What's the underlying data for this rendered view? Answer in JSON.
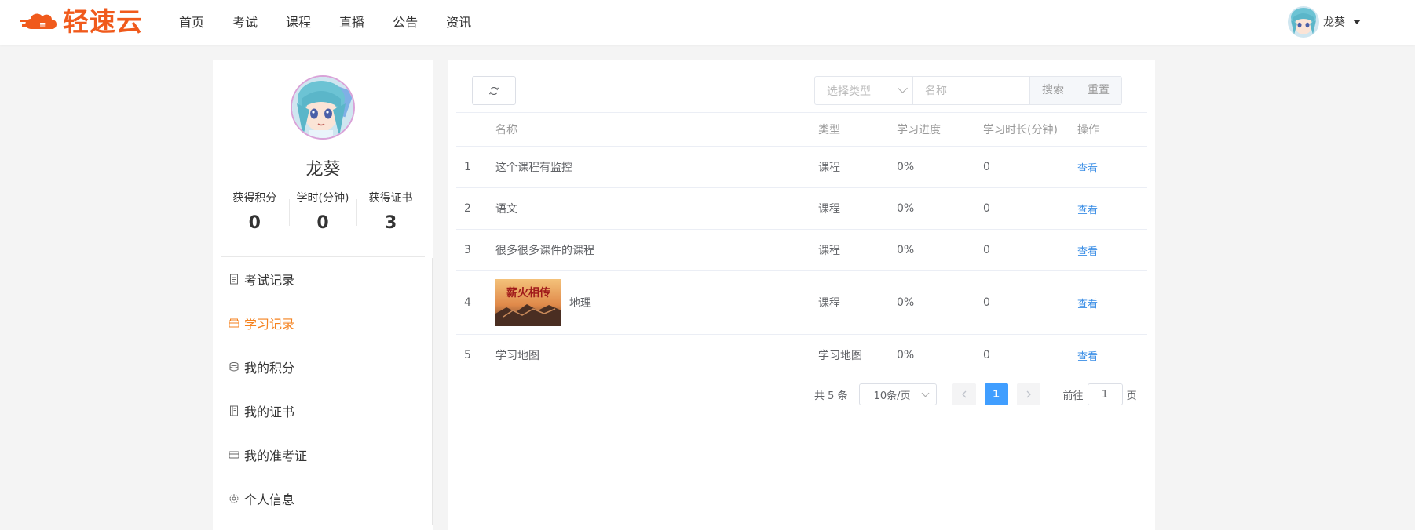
{
  "header": {
    "logo_text": "轻速云",
    "nav": [
      "首页",
      "考试",
      "课程",
      "直播",
      "公告",
      "资讯"
    ],
    "user_name": "龙葵"
  },
  "profile": {
    "name": "龙葵",
    "stats": [
      {
        "label": "获得积分",
        "value": "0"
      },
      {
        "label": "学时(分钟)",
        "value": "0"
      },
      {
        "label": "获得证书",
        "value": "3"
      }
    ]
  },
  "sidebar": {
    "items": [
      {
        "label": "考试记录",
        "icon": "document-icon",
        "active": false
      },
      {
        "label": "学习记录",
        "icon": "folder-icon",
        "active": true
      },
      {
        "label": "我的积分",
        "icon": "database-icon",
        "active": false
      },
      {
        "label": "我的证书",
        "icon": "notebook-icon",
        "active": false
      },
      {
        "label": "我的准考证",
        "icon": "card-icon",
        "active": false
      },
      {
        "label": "个人信息",
        "icon": "gear-icon",
        "active": false
      }
    ]
  },
  "filters": {
    "type_placeholder": "选择类型",
    "name_placeholder": "名称",
    "search_label": "搜索",
    "reset_label": "重置"
  },
  "table": {
    "columns": [
      "",
      "名称",
      "类型",
      "学习进度",
      "学习时长(分钟)",
      "操作"
    ],
    "rows": [
      {
        "index": "1",
        "name": "这个课程有监控",
        "type": "课程",
        "progress": "0%",
        "duration": "0",
        "action": "查看",
        "thumb": false
      },
      {
        "index": "2",
        "name": "语文",
        "type": "课程",
        "progress": "0%",
        "duration": "0",
        "action": "查看",
        "thumb": false
      },
      {
        "index": "3",
        "name": "很多很多课件的课程",
        "type": "课程",
        "progress": "0%",
        "duration": "0",
        "action": "查看",
        "thumb": false
      },
      {
        "index": "4",
        "name": "地理",
        "type": "课程",
        "progress": "0%",
        "duration": "0",
        "action": "查看",
        "thumb": true
      },
      {
        "index": "5",
        "name": "学习地图",
        "type": "学习地图",
        "progress": "0%",
        "duration": "0",
        "action": "查看",
        "thumb": false
      }
    ]
  },
  "pagination": {
    "total_text": "共 5 条",
    "page_size": "10条/页",
    "current_page": "1",
    "goto_prefix": "前往",
    "goto_value": "1",
    "goto_suffix": "页"
  },
  "thumbnail_text": "薪火相传",
  "colors": {
    "brand": "#f05a1c",
    "active": "#f5821f",
    "link": "#3a8ee6",
    "primary": "#409eff"
  }
}
